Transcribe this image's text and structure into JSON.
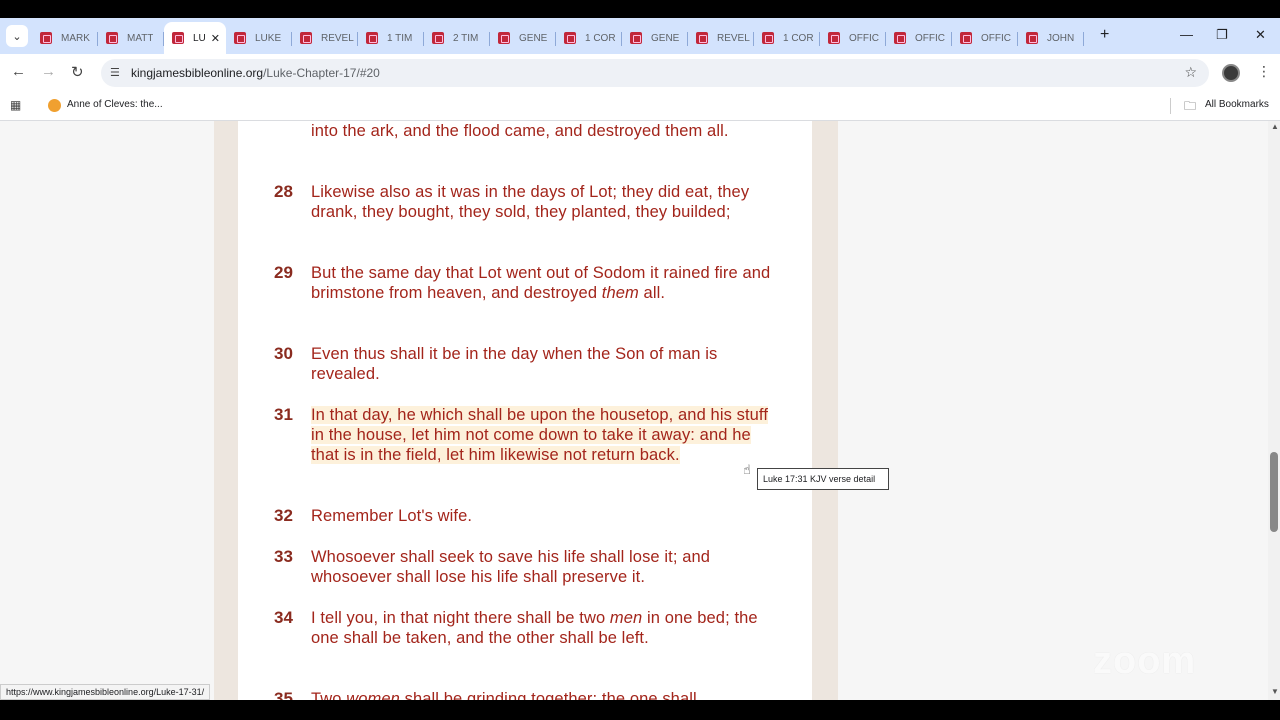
{
  "browser": {
    "tabs": [
      {
        "label": "MARK"
      },
      {
        "label": "MATT"
      },
      {
        "label": "LU",
        "active": true
      },
      {
        "label": "LUKE"
      },
      {
        "label": "REVEL"
      },
      {
        "label": "1 TIM"
      },
      {
        "label": "2 TIM"
      },
      {
        "label": "GENE"
      },
      {
        "label": "1 COR"
      },
      {
        "label": "GENE"
      },
      {
        "label": "REVEL"
      },
      {
        "label": "1 COR"
      },
      {
        "label": "OFFIC"
      },
      {
        "label": "OFFIC"
      },
      {
        "label": "OFFIC"
      },
      {
        "label": "JOHN"
      }
    ],
    "url_domain": "kingjamesbibleonline.org",
    "url_path": "/Luke-Chapter-17/#20",
    "bookmark_label": "Anne of Cleves: the...",
    "all_bookmarks_label": "All Bookmarks"
  },
  "verses": [
    {
      "num": "",
      "text": "into the ark, and the flood came, and destroyed them all."
    },
    {
      "num": "28",
      "text": "Likewise also as it was in the days of Lot; they did eat, they drank, they bought, they sold, they planted, they builded;"
    },
    {
      "num": "29",
      "text_before": "But the same day that Lot went out of Sodom it rained fire and brimstone from heaven, and destroyed ",
      "italic": "them",
      "text_after": " all."
    },
    {
      "num": "30",
      "text": "Even thus shall it be in the day when the Son of man is revealed."
    },
    {
      "num": "31",
      "text": "In that day, he which shall be upon the housetop, and his stuff in the house, let him not come down to take it away: and he that is in the field, let him likewise not return back.",
      "highlighted": true
    },
    {
      "num": "32",
      "text": "Remember Lot's wife."
    },
    {
      "num": "33",
      "text": "Whosoever shall seek to save his life shall lose it; and whosoever shall lose his life shall preserve it."
    },
    {
      "num": "34",
      "text_before": "I tell you, in that night there shall be two ",
      "italic": "men",
      "text_after": " in one bed; the one shall be taken, and the other shall be left."
    },
    {
      "num": "35",
      "text_before": "Two ",
      "italic": "women",
      "text_after": " shall be grinding together; the one shall"
    }
  ],
  "tooltip": "Luke 17:31 KJV verse detail",
  "status_url": "https://www.kingjamesbibleonline.org/Luke-17-31/",
  "watermark": "zoom"
}
